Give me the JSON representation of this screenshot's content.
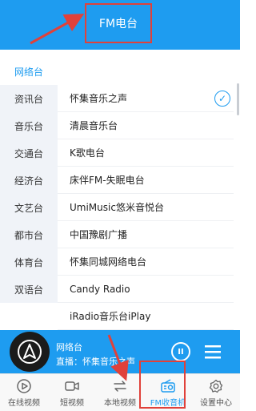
{
  "header": {
    "title": "FM电台"
  },
  "sidebar": {
    "items": [
      {
        "label": "网络台"
      },
      {
        "label": "资讯台"
      },
      {
        "label": "音乐台"
      },
      {
        "label": "交通台"
      },
      {
        "label": "经济台"
      },
      {
        "label": "文艺台"
      },
      {
        "label": "都市台"
      },
      {
        "label": "体育台"
      },
      {
        "label": "双语台"
      }
    ]
  },
  "stations": {
    "items": [
      {
        "label": "怀集音乐之声",
        "selected": true
      },
      {
        "label": "清晨音乐台"
      },
      {
        "label": "K歌电台"
      },
      {
        "label": "床伴FM-失眠电台"
      },
      {
        "label": "UmiMusic悠米音悦台"
      },
      {
        "label": "中国豫剧广播"
      },
      {
        "label": "怀集同城网络电台"
      },
      {
        "label": "Candy Radio"
      },
      {
        "label": "iRadio音乐台iPlay"
      }
    ]
  },
  "player": {
    "title": "网络台",
    "status": "直播：怀集音乐之声"
  },
  "tabs": {
    "items": [
      {
        "label": "在线视频",
        "icon": "play-circle-icon"
      },
      {
        "label": "短视频",
        "icon": "video-camera-icon"
      },
      {
        "label": "本地视频",
        "icon": "transfer-arrows-icon"
      },
      {
        "label": "FM收音机",
        "icon": "radio-icon",
        "active": true
      },
      {
        "label": "设置中心",
        "icon": "gear-icon"
      }
    ]
  },
  "colors": {
    "accent": "#1e9cf0",
    "annotation": "#e0413a"
  }
}
